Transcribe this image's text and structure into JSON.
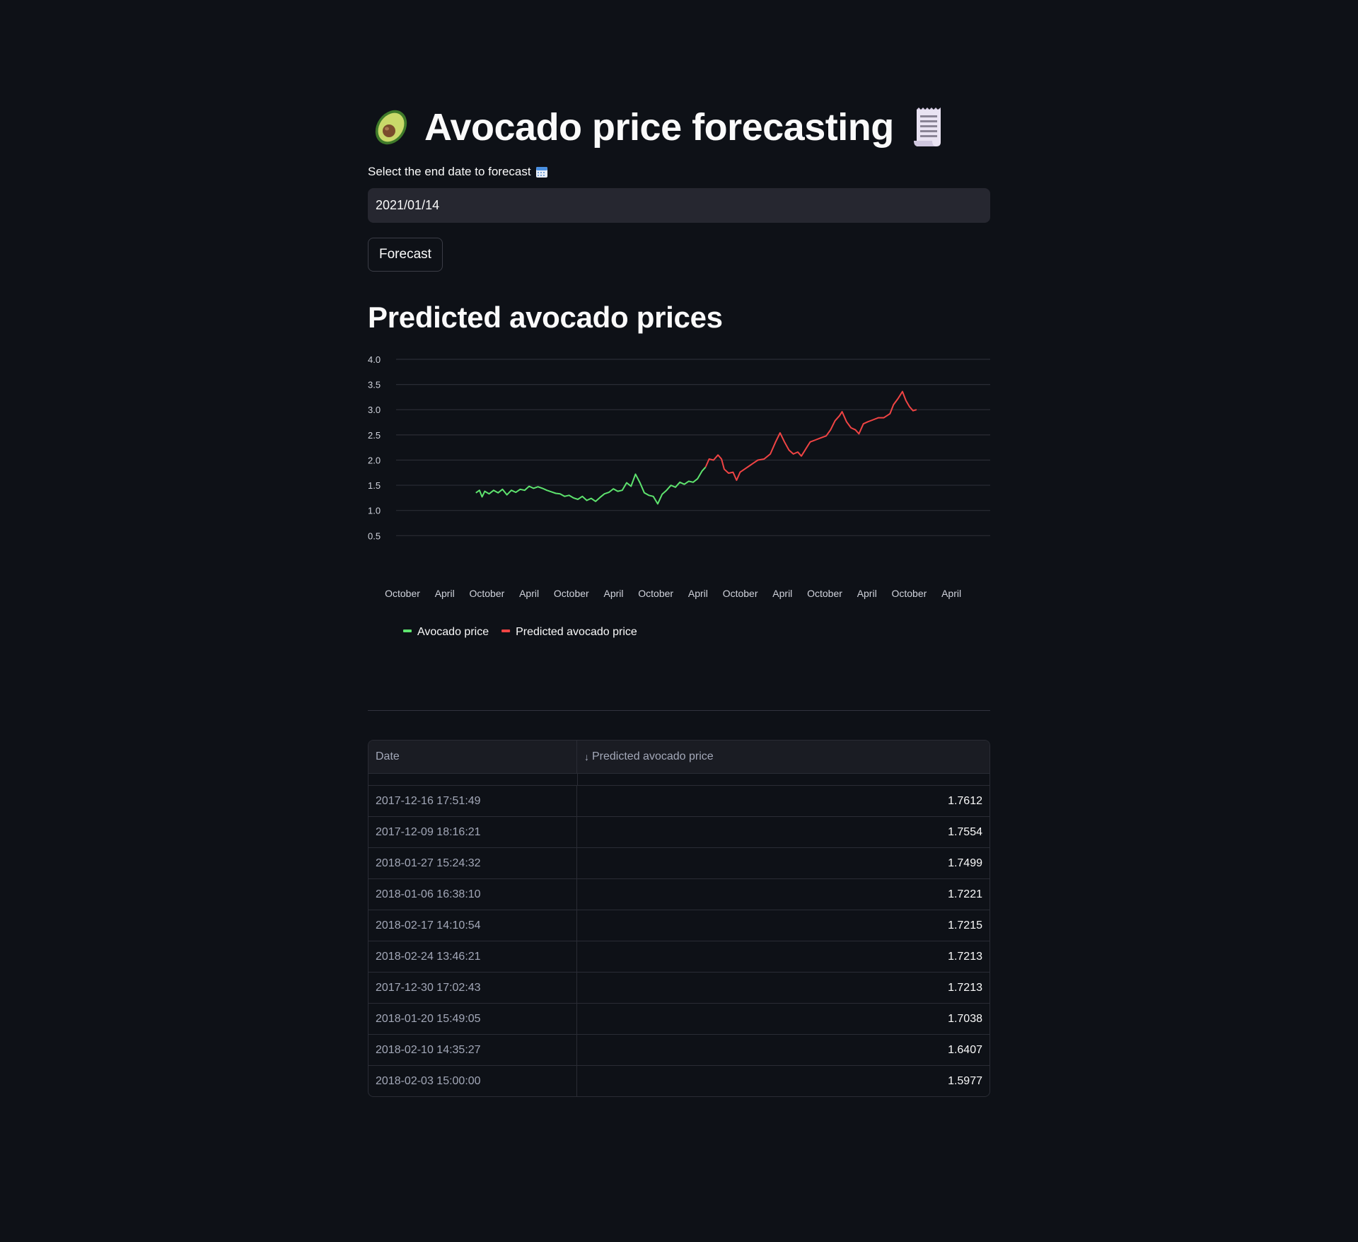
{
  "header": {
    "title": "Avocado price forecasting",
    "leading_icon": "avocado-icon",
    "trailing_icon": "receipt-icon"
  },
  "date_picker": {
    "label": "Select the end date to forecast",
    "label_icon": "calendar-icon",
    "value": "2021/01/14"
  },
  "forecast_button": {
    "label": "Forecast"
  },
  "section": {
    "title": "Predicted avocado prices"
  },
  "colors": {
    "actual": "#5ee36e",
    "predicted": "#f04444",
    "background": "#0e1117",
    "grid": "#2a2c35"
  },
  "chart_data": {
    "type": "line",
    "title": "",
    "xlabel": "",
    "ylabel": "",
    "ylim": [
      0.35,
      4.0
    ],
    "yticks": [
      "4.0",
      "3.5",
      "3.0",
      "2.5",
      "2.0",
      "1.5",
      "1.0",
      "0.5"
    ],
    "xticks": [
      "October",
      "April",
      "October",
      "April",
      "October",
      "April",
      "October",
      "April",
      "October",
      "April",
      "October",
      "April",
      "October",
      "April"
    ],
    "x_start": "2015-01-04",
    "grid": true,
    "legend_position": "bottom-left",
    "series": [
      {
        "name": "Avocado price",
        "color": "#5ee36e",
        "values": [
          [
            0,
            1.35
          ],
          [
            0.4,
            1.4
          ],
          [
            0.7,
            1.27
          ],
          [
            1.0,
            1.38
          ],
          [
            1.5,
            1.33
          ],
          [
            2.0,
            1.4
          ],
          [
            2.5,
            1.35
          ],
          [
            3.0,
            1.42
          ],
          [
            3.5,
            1.31
          ],
          [
            4.0,
            1.4
          ],
          [
            4.5,
            1.36
          ],
          [
            5.0,
            1.42
          ],
          [
            5.5,
            1.4
          ],
          [
            6.0,
            1.48
          ],
          [
            6.5,
            1.44
          ],
          [
            7.0,
            1.47
          ],
          [
            7.5,
            1.44
          ],
          [
            8.0,
            1.4
          ],
          [
            8.5,
            1.37
          ],
          [
            9.0,
            1.34
          ],
          [
            9.5,
            1.33
          ],
          [
            10.0,
            1.28
          ],
          [
            10.5,
            1.3
          ],
          [
            11.0,
            1.25
          ],
          [
            11.5,
            1.22
          ],
          [
            12.0,
            1.28
          ],
          [
            12.5,
            1.2
          ],
          [
            13.0,
            1.24
          ],
          [
            13.5,
            1.18
          ],
          [
            14.0,
            1.26
          ],
          [
            14.5,
            1.33
          ],
          [
            15.0,
            1.36
          ],
          [
            15.5,
            1.43
          ],
          [
            16.0,
            1.38
          ],
          [
            16.5,
            1.4
          ],
          [
            17.0,
            1.55
          ],
          [
            17.5,
            1.48
          ],
          [
            18.0,
            1.72
          ],
          [
            18.5,
            1.55
          ],
          [
            19.0,
            1.35
          ],
          [
            19.5,
            1.3
          ],
          [
            20.0,
            1.28
          ],
          [
            20.5,
            1.13
          ],
          [
            21.0,
            1.32
          ],
          [
            21.5,
            1.4
          ],
          [
            22.0,
            1.5
          ],
          [
            22.5,
            1.46
          ],
          [
            23.0,
            1.56
          ],
          [
            23.5,
            1.52
          ],
          [
            24.0,
            1.58
          ],
          [
            24.5,
            1.56
          ],
          [
            25.0,
            1.63
          ],
          [
            25.5,
            1.78
          ],
          [
            25.9,
            1.86
          ]
        ]
      },
      {
        "name": "Predicted avocado price",
        "color": "#f04444",
        "values": [
          [
            25.9,
            1.86
          ],
          [
            26.3,
            2.02
          ],
          [
            26.8,
            2.0
          ],
          [
            27.3,
            2.1
          ],
          [
            27.7,
            2.02
          ],
          [
            28.0,
            1.82
          ],
          [
            28.5,
            1.74
          ],
          [
            29.0,
            1.76
          ],
          [
            29.4,
            1.6
          ],
          [
            29.8,
            1.76
          ],
          [
            30.3,
            1.82
          ],
          [
            30.8,
            1.88
          ],
          [
            31.3,
            1.94
          ],
          [
            31.8,
            2.0
          ],
          [
            32.5,
            2.02
          ],
          [
            33.2,
            2.12
          ],
          [
            33.8,
            2.36
          ],
          [
            34.3,
            2.54
          ],
          [
            34.8,
            2.36
          ],
          [
            35.3,
            2.2
          ],
          [
            35.8,
            2.12
          ],
          [
            36.3,
            2.16
          ],
          [
            36.7,
            2.08
          ],
          [
            37.2,
            2.22
          ],
          [
            37.7,
            2.36
          ],
          [
            38.3,
            2.4
          ],
          [
            38.9,
            2.44
          ],
          [
            39.5,
            2.48
          ],
          [
            40.0,
            2.6
          ],
          [
            40.5,
            2.78
          ],
          [
            41.0,
            2.88
          ],
          [
            41.3,
            2.96
          ],
          [
            41.8,
            2.76
          ],
          [
            42.3,
            2.64
          ],
          [
            42.8,
            2.6
          ],
          [
            43.2,
            2.52
          ],
          [
            43.7,
            2.72
          ],
          [
            44.2,
            2.76
          ],
          [
            44.8,
            2.8
          ],
          [
            45.4,
            2.84
          ],
          [
            46.0,
            2.84
          ],
          [
            46.7,
            2.92
          ],
          [
            47.1,
            3.1
          ],
          [
            47.6,
            3.22
          ],
          [
            48.1,
            3.36
          ],
          [
            48.5,
            3.18
          ],
          [
            48.9,
            3.06
          ],
          [
            49.3,
            2.98
          ],
          [
            49.7,
            3.0
          ]
        ]
      }
    ]
  },
  "table": {
    "columns": [
      "Date",
      "Predicted avocado price"
    ],
    "sort_indicator": "↓",
    "rows": [
      {
        "date": "2017-12-16 17:51:49",
        "price": "1.7612"
      },
      {
        "date": "2017-12-09 18:16:21",
        "price": "1.7554"
      },
      {
        "date": "2018-01-27 15:24:32",
        "price": "1.7499"
      },
      {
        "date": "2018-01-06 16:38:10",
        "price": "1.7221"
      },
      {
        "date": "2018-02-17 14:10:54",
        "price": "1.7215"
      },
      {
        "date": "2018-02-24 13:46:21",
        "price": "1.7213"
      },
      {
        "date": "2017-12-30 17:02:43",
        "price": "1.7213"
      },
      {
        "date": "2018-01-20 15:49:05",
        "price": "1.7038"
      },
      {
        "date": "2018-02-10 14:35:27",
        "price": "1.6407"
      },
      {
        "date": "2018-02-03 15:00:00",
        "price": "1.5977"
      }
    ]
  }
}
